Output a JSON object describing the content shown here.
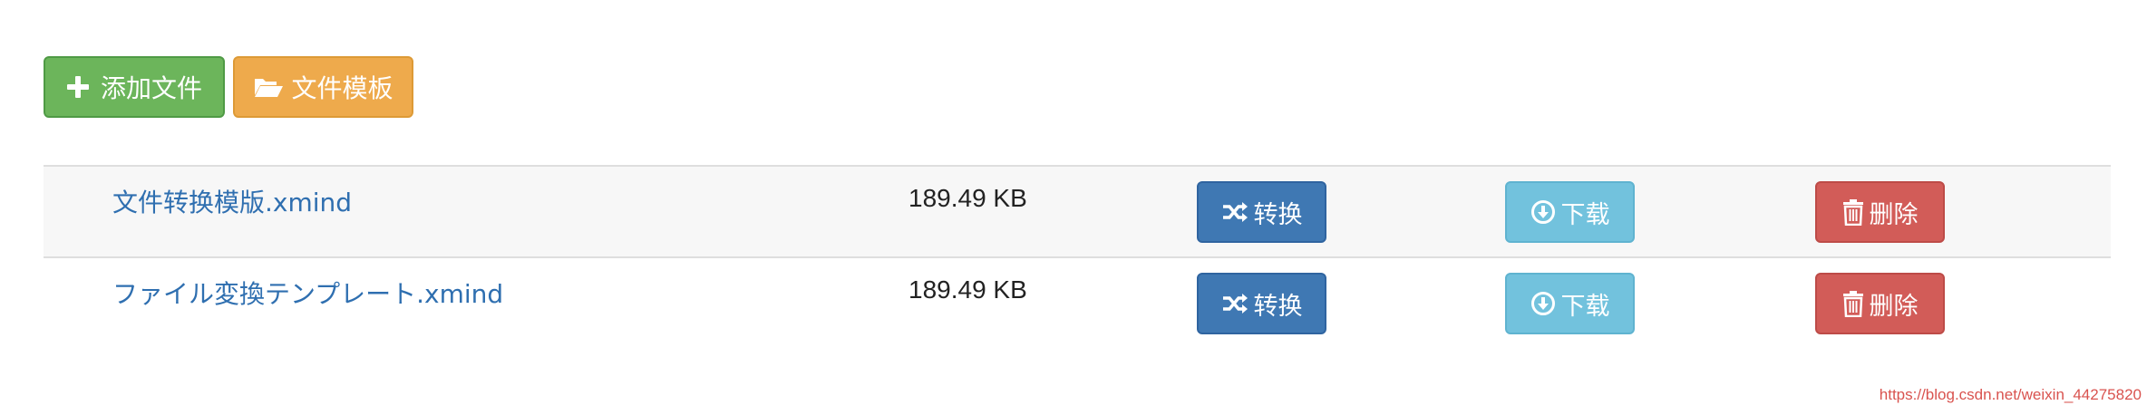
{
  "toolbar": {
    "add_label": "添加文件",
    "template_label": "文件模板"
  },
  "files": [
    {
      "name": "文件转换模版.xmind",
      "size": "189.49 KB",
      "convert_label": "转换",
      "download_label": "下载",
      "delete_label": "删除"
    },
    {
      "name": "ファイル変換テンプレート.xmind",
      "size": "189.49 KB",
      "convert_label": "转换",
      "download_label": "下载",
      "delete_label": "删除"
    }
  ],
  "watermark": "https://blog.csdn.net/weixin_44275820",
  "icons": {
    "add": "plus-icon",
    "template": "folder-open-icon",
    "convert": "shuffle-icon",
    "download": "download-circle-icon",
    "delete": "trash-icon"
  },
  "colors": {
    "add": "#6cb55b",
    "template": "#eeaa4c",
    "convert": "#3f78b3",
    "download": "#72c2dd",
    "delete": "#d25c58",
    "link": "#2f6fb0"
  }
}
